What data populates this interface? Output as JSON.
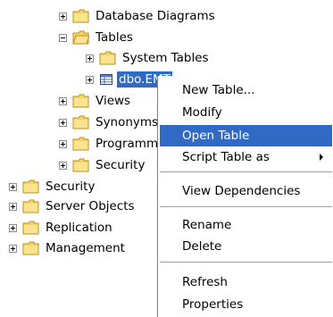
{
  "tree": {
    "database_diagrams": "Database Diagrams",
    "tables": "Tables",
    "system_tables": "System Tables",
    "selected_table": "dbo.EMT",
    "views": "Views",
    "synonyms": "Synonyms",
    "programmability": "Programmability",
    "security_inner": "Security",
    "security": "Security",
    "server_objects": "Server Objects",
    "replication": "Replication",
    "management": "Management"
  },
  "context_menu": {
    "new_table": "New Table...",
    "modify": "Modify",
    "open_table": "Open Table",
    "script_table_as": "Script Table as",
    "view_dependencies": "View Dependencies",
    "rename": "Rename",
    "delete": "Delete",
    "refresh": "Refresh",
    "properties": "Properties"
  },
  "colors": {
    "selection": "#316ac5",
    "folder": "#f6d36b"
  }
}
